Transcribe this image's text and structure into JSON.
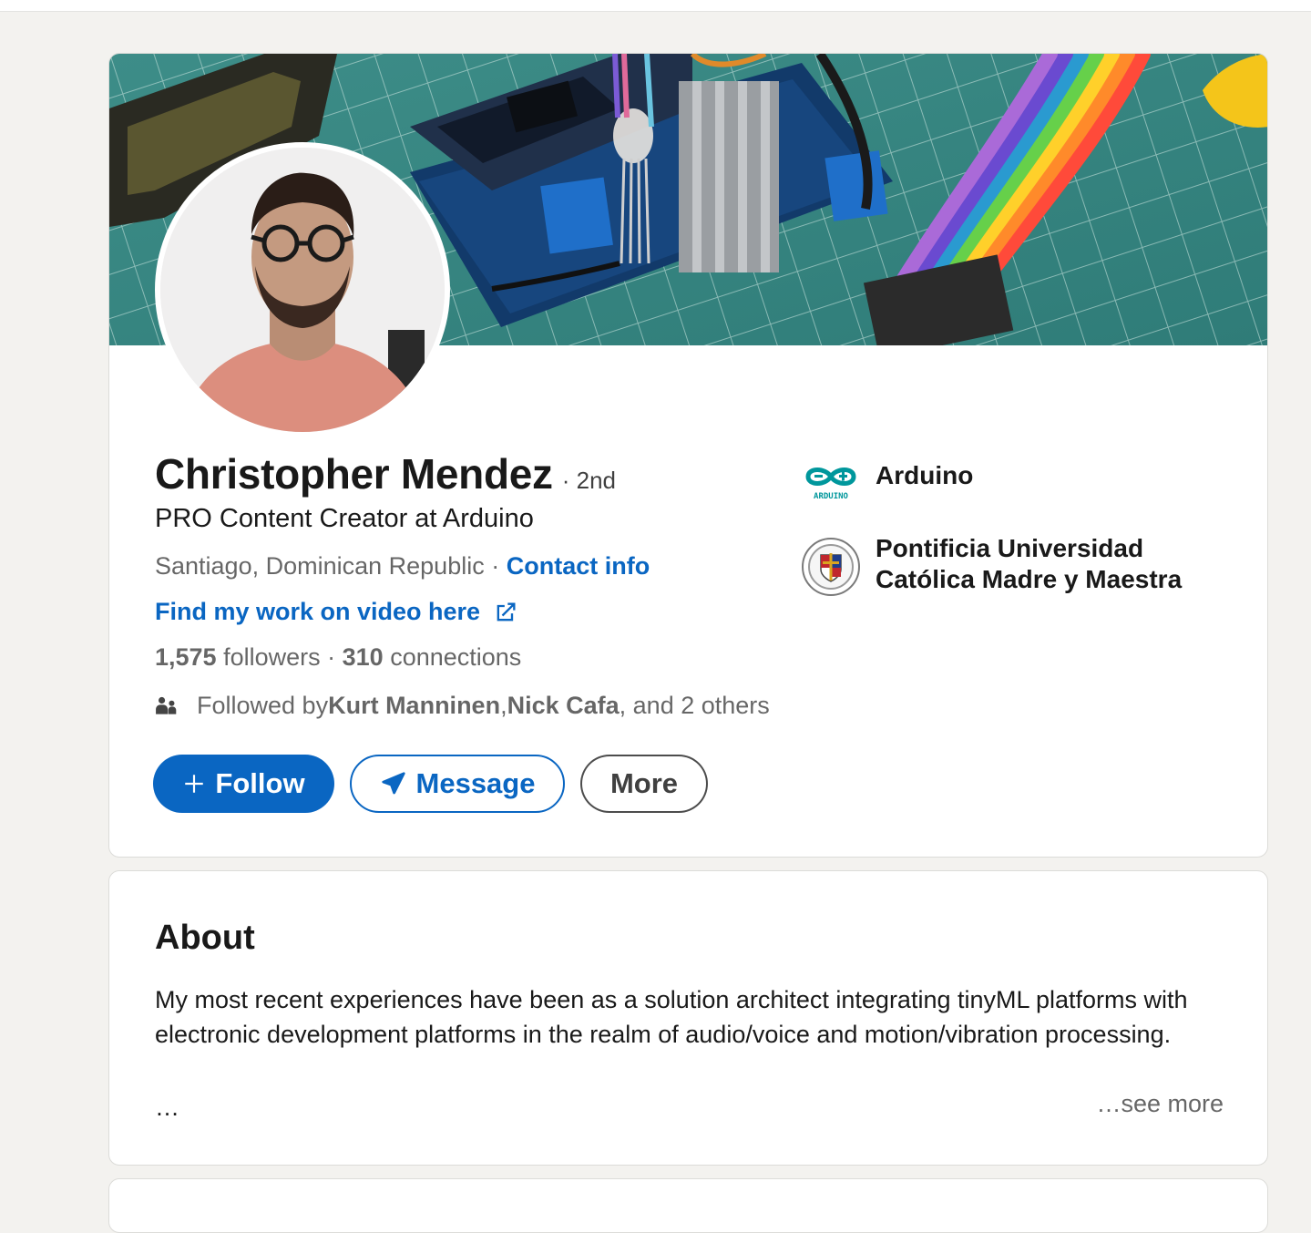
{
  "profile": {
    "name": "Christopher Mendez",
    "degree": "· 2nd",
    "headline": "PRO Content Creator at Arduino",
    "location": "Santiago, Dominican Republic",
    "location_sep": " · ",
    "contact_info": "Contact info",
    "video_link": "Find my work on video here",
    "followers_count": "1,575",
    "followers_label": " followers",
    "stats_sep": "  · ",
    "connections_count": "310",
    "connections_label": " connections",
    "followed_prefix": "Followed by ",
    "followed_name1": "Kurt Manninen",
    "followed_sep": ", ",
    "followed_name2": "Nick Cafa",
    "followed_suffix": ", and 2 others"
  },
  "actions": {
    "follow_label": "Follow",
    "message_label": "Message",
    "more_label": "More"
  },
  "orgs": [
    {
      "name": "Arduino",
      "logo_icon": "arduino-logo-icon",
      "logo_text": "ARDUINO"
    },
    {
      "name": "Pontificia Universidad Católica Madre y Maestra",
      "logo_icon": "university-seal-icon"
    }
  ],
  "about": {
    "title": "About",
    "text": "My most recent experiences have been as a solution architect integrating tinyML platforms with electronic development platforms in the realm of audio/voice and motion/vibration processing.",
    "ellipsis": "…",
    "see_more": "…see more"
  },
  "colors": {
    "accent": "#0a66c2",
    "background": "#f3f2ef",
    "arduino_teal": "#00979c"
  }
}
